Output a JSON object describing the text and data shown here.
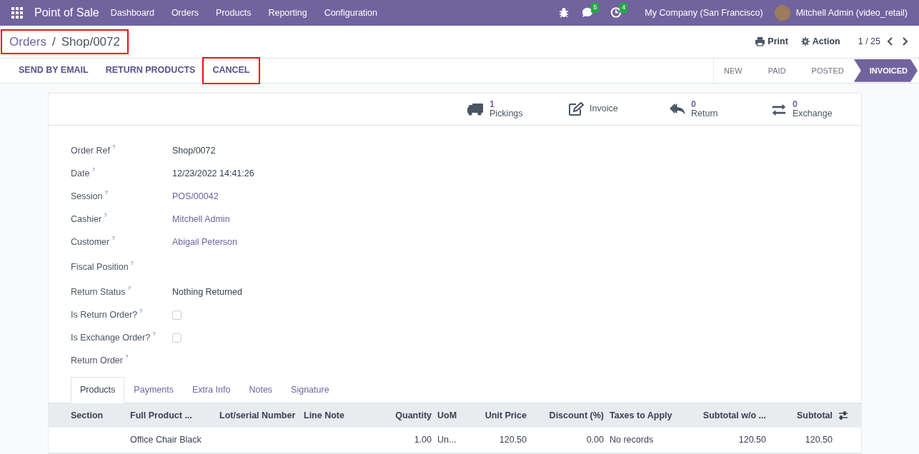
{
  "app": {
    "title": "Point of Sale"
  },
  "menu": [
    "Dashboard",
    "Orders",
    "Products",
    "Reporting",
    "Configuration"
  ],
  "systray": {
    "messages_count": "5",
    "activities_count": "4",
    "company": "My Company (San Francisco)",
    "user": "Mitchell Admin (video_retail)"
  },
  "breadcrumb": {
    "parent": "Orders",
    "separator": "/",
    "current": "Shop/0072",
    "highlighted": true
  },
  "toolbar": {
    "print": "Print",
    "action": "Action",
    "pager": "1 / 25"
  },
  "header_buttons": [
    {
      "label": "SEND BY EMAIL",
      "highlighted": false
    },
    {
      "label": "RETURN PRODUCTS",
      "highlighted": false
    },
    {
      "label": "CANCEL",
      "highlighted": true
    }
  ],
  "statusbar": [
    {
      "label": "NEW",
      "selected": false
    },
    {
      "label": "PAID",
      "selected": false
    },
    {
      "label": "POSTED",
      "selected": false
    },
    {
      "label": "INVOICED",
      "selected": true
    }
  ],
  "smart_buttons": [
    {
      "kind": "truck",
      "count": "1",
      "label": "Pickings"
    },
    {
      "kind": "invoice",
      "label": "Invoice"
    },
    {
      "kind": "return",
      "count": "0",
      "label": "Return"
    },
    {
      "kind": "exchange",
      "count": "0",
      "label": "Exchange"
    }
  ],
  "fields": [
    {
      "label": "Order Ref",
      "help": "?",
      "kind": "text",
      "value": "Shop/0072"
    },
    {
      "label": "Date",
      "help": "?",
      "kind": "text",
      "value": "12/23/2022 14:41:26"
    },
    {
      "label": "Session",
      "help": "?",
      "kind": "link",
      "value": "POS/00042"
    },
    {
      "label": "Cashier",
      "help": "?",
      "kind": "link",
      "value": "Mitchell Admin"
    },
    {
      "label": "Customer",
      "help": "?",
      "kind": "link",
      "value": "Abigail Peterson"
    },
    {
      "label": "Fiscal Position",
      "help": "?",
      "kind": "empty"
    },
    {
      "label": "Return Status",
      "help": "?",
      "kind": "text",
      "value": "Nothing Returned"
    },
    {
      "label": "Is Return Order?",
      "help": "?",
      "kind": "checkbox",
      "checked": false
    },
    {
      "label": "Is Exchange Order?",
      "help": "?",
      "kind": "checkbox",
      "checked": false
    },
    {
      "label": "Return Order",
      "help": "?",
      "kind": "empty"
    }
  ],
  "tabs": [
    {
      "label": "Products",
      "selected": true
    },
    {
      "label": "Payments",
      "selected": false
    },
    {
      "label": "Extra Info",
      "selected": false
    },
    {
      "label": "Notes",
      "selected": false
    },
    {
      "label": "Signature",
      "selected": false
    }
  ],
  "table": {
    "columns": [
      "Section",
      "Full Product ...",
      "Lot/serial Number",
      "Line Note",
      "Quantity",
      "UoM",
      "Unit Price",
      "Discount (%)",
      "Taxes to Apply",
      "Subtotal w/o ...",
      "Subtotal"
    ],
    "rows": [
      [
        "",
        "Office Chair Black",
        "",
        "",
        "1.00",
        "Un...",
        "120.50",
        "0.00",
        "No records",
        "120.50",
        "120.50"
      ]
    ]
  }
}
